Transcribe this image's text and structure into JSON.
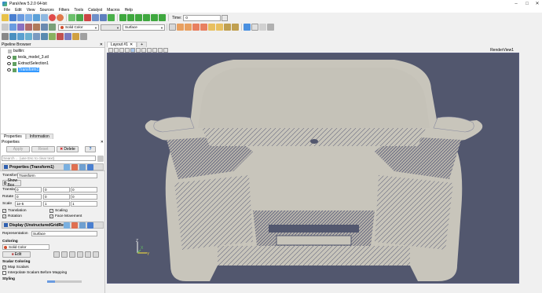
{
  "window": {
    "title": "ParaView 5.2.0 64-bit"
  },
  "menubar": [
    "File",
    "Edit",
    "View",
    "Sources",
    "Filters",
    "Tools",
    "Catalyst",
    "Macros",
    "Help"
  ],
  "toolbar": {
    "coloring_value": "Solid Color",
    "representation_value": "Surface",
    "time_label": "Time:",
    "time_value": "0"
  },
  "pipeline_browser": {
    "title": "Pipeline Browser",
    "items": [
      {
        "label": "builtin:"
      },
      {
        "label": "tesla_model_3.stl"
      },
      {
        "label": "ExtractSelection1"
      },
      {
        "label": "Transform1"
      }
    ]
  },
  "panel_tabs": [
    "Properties",
    "Information"
  ],
  "properties": {
    "dock_title": "Properties",
    "apply": "Apply",
    "reset": "Reset",
    "delete": "Delete",
    "help": "?",
    "search_placeholder": "Search ... (use Esc to clear text)",
    "section_transform": "Properties (Transform1)",
    "transform_label": "Transform",
    "transform_value": "Transform",
    "show_box": "Show Box",
    "translate_label": "Translate",
    "translate": [
      "0",
      "0",
      "0"
    ],
    "rotate_label": "Rotate",
    "rotate": [
      "0",
      "0",
      "0"
    ],
    "scale_label": "Scale",
    "scale": [
      "1e-5",
      "1",
      "1"
    ],
    "cb_translation": "Translation",
    "cb_scaling": "Scaling",
    "cb_rotation": "Rotation",
    "cb_face_movement": "Face Movement",
    "section_display": "Display (UnstructuredGridRep",
    "representation_label": "Representation",
    "representation_value": "Surface",
    "coloring_label": "Coloring",
    "coloring_value": "Solid Color",
    "edit": "Edit",
    "scalar_coloring": "Scalar Coloring",
    "map_scalars": "Map Scalars",
    "interpolate": "Interpolate Scalars Before Mapping",
    "styling": "Styling"
  },
  "layout": {
    "tab": "Layout #1",
    "render_view_label": "RenderView1"
  },
  "colors": {
    "background": "#52576e",
    "mesh": "#c8c5bb",
    "selection": "#3399ff"
  }
}
